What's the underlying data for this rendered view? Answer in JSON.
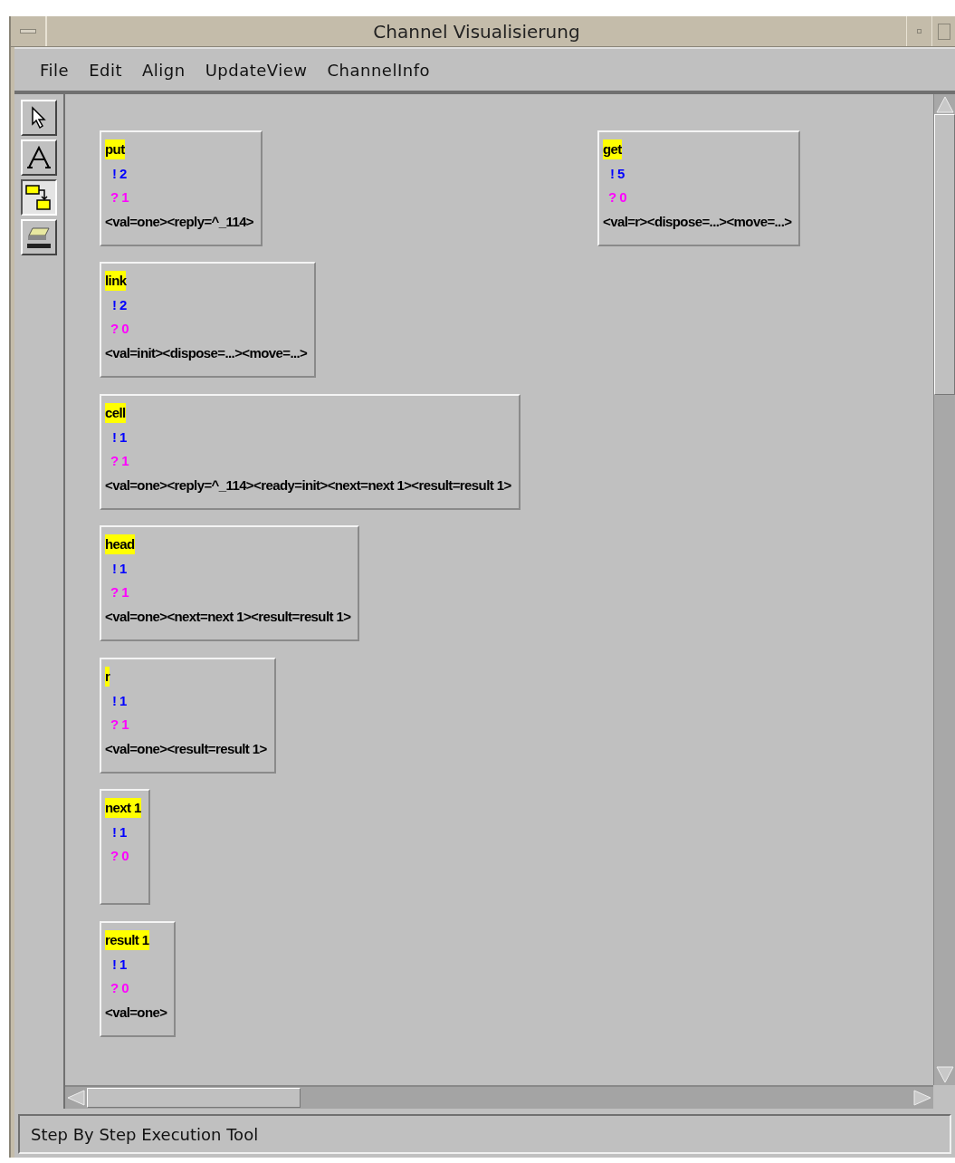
{
  "window": {
    "title": "Channel Visualisierung"
  },
  "menu": [
    "File",
    "Edit",
    "Align",
    "UpdateView",
    "ChannelInfo"
  ],
  "tools": [
    {
      "kind": "pointer",
      "selected": false
    },
    {
      "kind": "text",
      "selected": false
    },
    {
      "kind": "connect",
      "selected": true
    },
    {
      "kind": "eraser",
      "selected": false
    }
  ],
  "channels": [
    {
      "name": "put",
      "send": "! 2",
      "receive": "? 1",
      "val": "<val=one><reply=^_114>"
    },
    {
      "name": "get",
      "send": "! 5",
      "receive": "? 0",
      "val": "<val=r><dispose=...><move=...>"
    },
    {
      "name": "link",
      "send": "! 2",
      "receive": "? 0",
      "val": "<val=init><dispose=...><move=...>"
    },
    {
      "name": "cell",
      "send": "! 1",
      "receive": "? 1",
      "val": "<val=one><reply=^_114><ready=init><next=next 1><result=result 1>"
    },
    {
      "name": "head",
      "send": "! 1",
      "receive": "? 1",
      "val": "<val=one><next=next 1><result=result 1>"
    },
    {
      "name": "r",
      "send": "! 1",
      "receive": "? 1",
      "val": "<val=one><result=result 1>"
    },
    {
      "name": "next 1",
      "send": "! 1",
      "receive": "? 0"
    },
    {
      "name": "result 1",
      "send": "! 1",
      "receive": "? 0",
      "val": "<val=one>"
    }
  ],
  "status_bar": "Step By Step Execution Tool"
}
